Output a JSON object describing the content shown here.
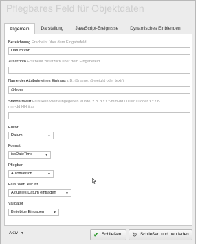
{
  "dialog": {
    "title": "Pflegbares Feld für Objektdaten"
  },
  "tabs": [
    {
      "label": "Allgemein"
    },
    {
      "label": "Darstellung"
    },
    {
      "label": "JavaScript-Ereignisse"
    },
    {
      "label": "Dynamisches Einblenden"
    }
  ],
  "fields": {
    "bezeichnung": {
      "label": "Bezeichnung",
      "hint": "Erscheint über dem Eingabefeld",
      "value": "Datum von"
    },
    "zusatzinfo": {
      "label": "Zusatzinfo",
      "hint": "Erscheint zusätzlich über dem Eingabefeld",
      "value": ""
    },
    "attribut": {
      "label": "Name der Attribute eines Eintrags",
      "hint": "z.B. @name, @weight oder text()",
      "value": "@from"
    },
    "standardwert": {
      "label": "Standardwert",
      "hint_line1": "Falls kein Wert eingegeben wurde, z.B. YYYY-mm-dd 00:00:00 oder YYYY-",
      "hint_line2": "mm-dd HH:ii:ss",
      "value": ""
    },
    "editor": {
      "label": "Editor",
      "value": "Datum"
    },
    "format": {
      "label": "Format",
      "value": "isoDateTime"
    },
    "pflegbar": {
      "label": "Pflegbar",
      "value": "Automatisch"
    },
    "leer": {
      "label": "Falls Wert leer ist",
      "value": "Aktuelles Datum eintragen"
    },
    "validator": {
      "label": "Validator",
      "value": "Beliebige Eingaben"
    }
  },
  "footer": {
    "status": "Aktiv",
    "save_close_label": "Schließen",
    "save_reload_label": "Schließen und neu laden"
  },
  "icons": {
    "save_close": "check-icon",
    "save_reload": "reload-icon",
    "status_dropdown": "caret-down-icon"
  },
  "colors": {
    "check": "#2e9a2e",
    "hint": "#9a9a9a",
    "title": "#cfcfcf"
  }
}
